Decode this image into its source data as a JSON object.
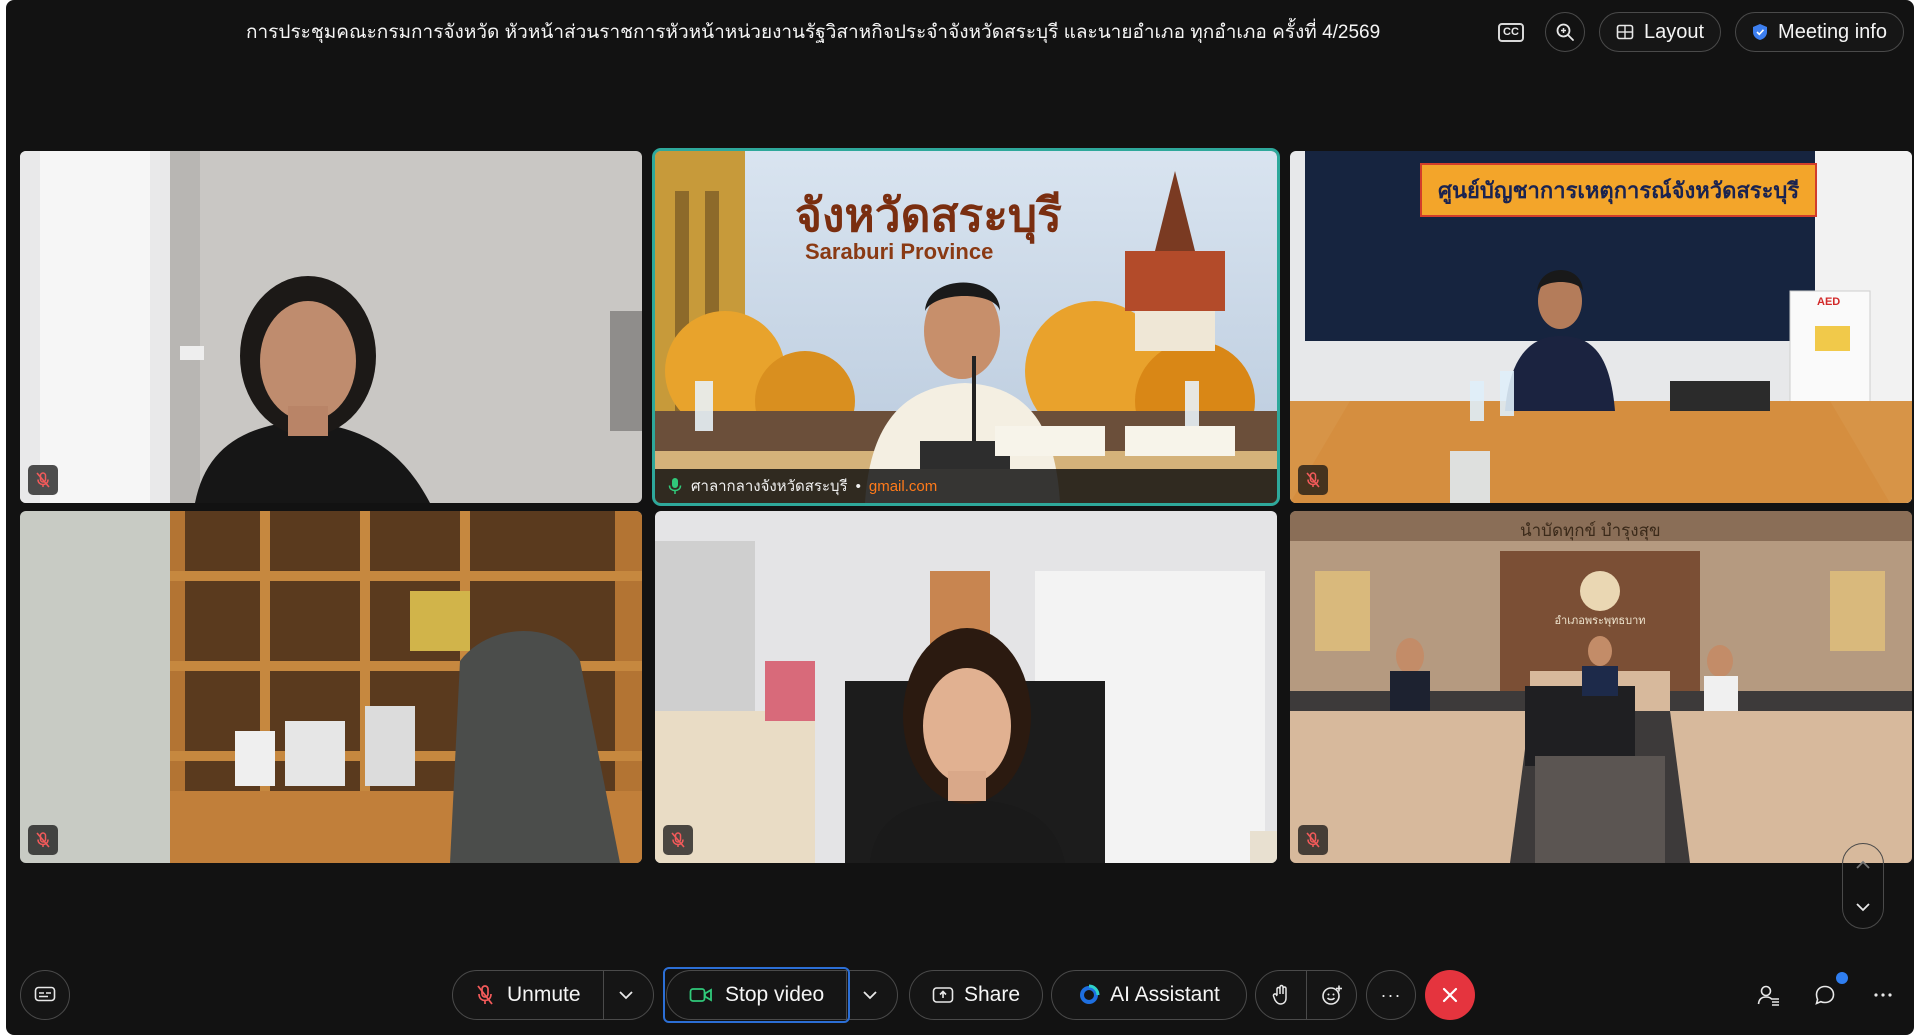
{
  "meeting": {
    "title": "การประชุมคณะกรมการจังหวัด หัวหน้าส่วนราชการหัวหน้าหน่วยงานรัฐวิสาหกิจประจำจังหวัดสระบุรี และนายอำเภอ ทุกอำเภอ ครั้งที่ 4/2569"
  },
  "top_bar": {
    "cc_label": "CC",
    "layout_label": "Layout",
    "meeting_info_label": "Meeting info"
  },
  "tiles": [
    {
      "id": "tile-1",
      "muted": true,
      "active": false
    },
    {
      "id": "tile-2",
      "muted": false,
      "active": true,
      "name": "ศาลากลางจังหวัดสระบุรี",
      "separator": "•",
      "email": "gmail.com",
      "backdrop_title": "จังหวัดสระบุรี",
      "backdrop_subtitle": "Saraburi Province"
    },
    {
      "id": "tile-3",
      "muted": true,
      "active": false,
      "banner": "ศูนย์บัญชาการเหตุการณ์จังหวัดสระบุรี",
      "aed": "AED"
    },
    {
      "id": "tile-4",
      "muted": true,
      "active": false
    },
    {
      "id": "tile-5",
      "muted": true,
      "active": false
    },
    {
      "id": "tile-6",
      "muted": true,
      "active": false,
      "wall_text": "นำบัดทุกข์ บำรุงสุข",
      "emblem_text": "อำเภอพระพุทธบาท"
    }
  ],
  "toolbar": {
    "unmute_label": "Unmute",
    "stop_video_label": "Stop video",
    "share_label": "Share",
    "ai_assistant_label": "AI Assistant",
    "more_label": "···"
  },
  "colors": {
    "background": "#121212",
    "active_speaker": "#2ea89b",
    "leave": "#e5343e",
    "focus": "#2c6fd6",
    "notification": "#2f7ef0",
    "email_accent": "#ff7a1a"
  }
}
